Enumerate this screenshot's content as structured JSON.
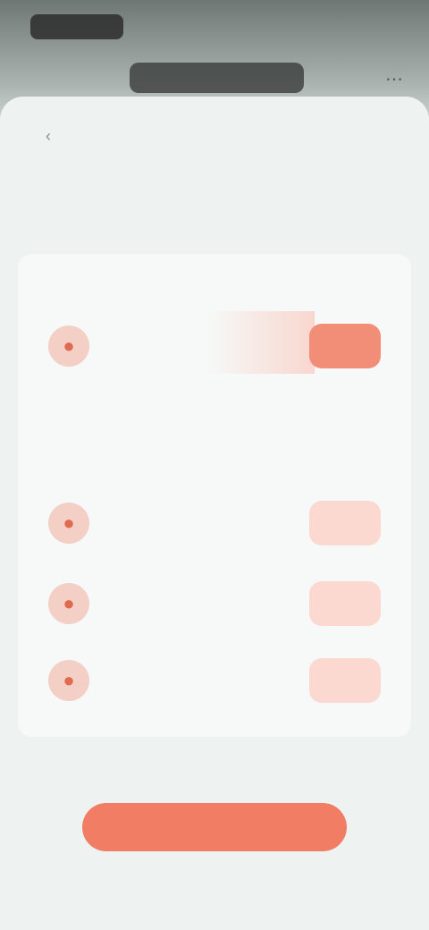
{
  "status": {
    "time": "",
    "indicators": ""
  },
  "background_screen": {
    "title": "",
    "action_icon": "more-icon"
  },
  "sheet": {
    "back_icon": "back-arrow-icon",
    "title": "",
    "description": ""
  },
  "section_primary": {
    "title": "",
    "item": {
      "avatar_icon": "person-icon",
      "name": "",
      "action_label": ""
    }
  },
  "section_secondary": {
    "title": "",
    "subtitle": "",
    "items": [
      {
        "avatar_icon": "person-icon",
        "name": "",
        "action_label": ""
      },
      {
        "avatar_icon": "person-icon",
        "name": "",
        "action_label": ""
      },
      {
        "avatar_icon": "person-icon",
        "name": "",
        "action_label": ""
      }
    ]
  },
  "footer": {
    "note": "",
    "cta_label": ""
  },
  "colors": {
    "accent": "#f07d64",
    "accent_soft": "#fbd9d1",
    "sheet_background": "#eef3f2"
  }
}
